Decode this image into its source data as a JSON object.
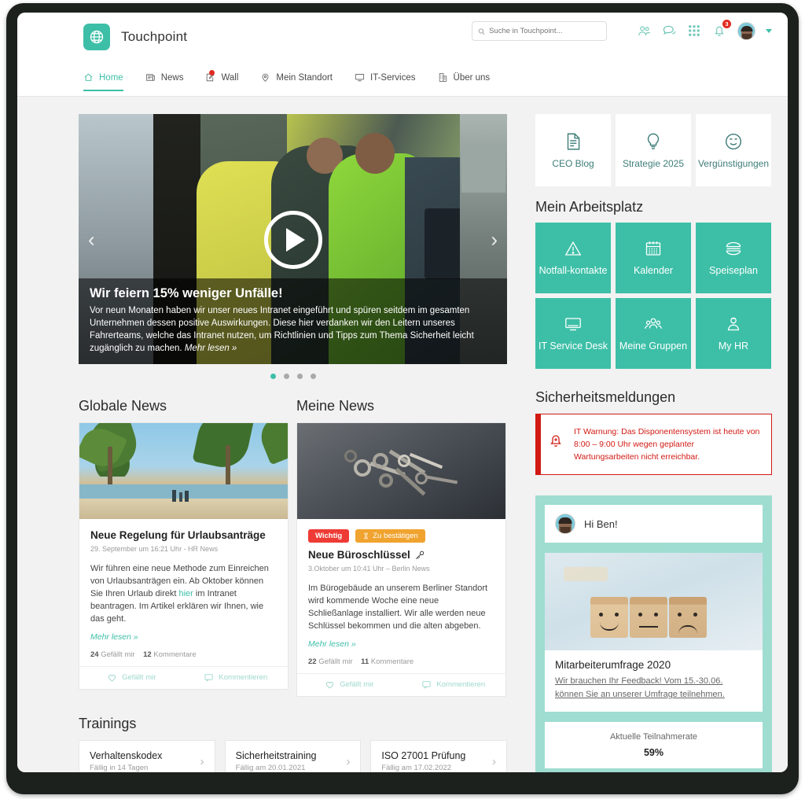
{
  "brand": {
    "name": "Touchpoint",
    "logo_icon": "globe-icon",
    "accent": "#3dbfa7"
  },
  "header": {
    "search": {
      "placeholder": "Suche in Touchpoint...",
      "value": "",
      "icon": "search-icon"
    },
    "icons": [
      {
        "name": "people-icon",
        "label": "Kontakte"
      },
      {
        "name": "chat-icon",
        "label": "Chat"
      },
      {
        "name": "apps-grid-icon",
        "label": "Apps"
      },
      {
        "name": "bell-icon",
        "label": "Benachrichtigungen",
        "badge": "3"
      }
    ],
    "avatar": {
      "name": "user-avatar",
      "caret": "chevron-down-icon"
    }
  },
  "nav": {
    "items": [
      {
        "label": "Home",
        "icon": "home-icon",
        "active": true,
        "dot": false
      },
      {
        "label": "News",
        "icon": "newspaper-icon",
        "active": false,
        "dot": false
      },
      {
        "label": "Wall",
        "icon": "pencil-note-icon",
        "active": false,
        "dot": true
      },
      {
        "label": "Mein Standort",
        "icon": "location-pin-icon",
        "active": false,
        "dot": false
      },
      {
        "label": "IT-Services",
        "icon": "monitor-icon",
        "active": false,
        "dot": false
      },
      {
        "label": "Über uns",
        "icon": "building-icon",
        "active": false,
        "dot": false
      }
    ]
  },
  "hero": {
    "title": "Wir feiern 15% weniger Unfälle!",
    "text": "Vor neun Monaten haben wir unser neues Intranet eingeführt und spüren seitdem im gesamten Unternehmen dessen positive Auswirkungen. Diese hier verdanken wir den Leitern unseres Fahrerteams, welche das Intranet nutzen, um Richtlinien und Tipps zum Thema Sicherheit leicht zugänglich zu machen.",
    "more": "Mehr lesen »",
    "play_icon": "play-icon",
    "prev_icon": "chevron-left-icon",
    "next_icon": "chevron-right-icon",
    "slides": 4,
    "active_slide": 1
  },
  "news": {
    "global": {
      "heading": "Globale News",
      "image": "beach-palm-trees-photo",
      "title": "Neue Regelung für Urlaubsanträge",
      "meta": "29. September um 16:21 Uhr  -  HR News",
      "text_before": "Wir führen eine neue Methode zum Einreichen von Urlaubsanträgen ein. Ab Oktober können Sie Ihren Urlaub direkt ",
      "link": "hier",
      "text_after": " im Intranet beantragen. Im Artikel erklären wir Ihnen, wie das geht.",
      "more": "Mehr lesen »",
      "likes_count": "24",
      "likes_label": "Gefällt mir",
      "comments_count": "12",
      "comments_label": "Kommentare",
      "action_like": "Gefällt mir",
      "action_comment": "Kommentieren"
    },
    "mine": {
      "heading": "Meine News",
      "image": "keys-on-dark-table-photo",
      "badges": [
        {
          "label": "Wichtig",
          "color": "#ee3b35"
        },
        {
          "label": "Zu bestätigen",
          "color": "#f0a32e",
          "icon": "hourglass-icon"
        }
      ],
      "title": "Neue Büroschlüssel",
      "title_icon": "key-icon",
      "meta": "3.Oktober um 10:41 Uhr – Berlin News",
      "text": "Im Bürogebäude an unserem Berliner Standort wird kommende Woche eine neue Schließanlage installiert. Wir alle werden neue Schlüssel bekommen und die alten abgeben.",
      "more": "Mehr lesen »",
      "likes_count": "22",
      "likes_label": "Gefällt mir",
      "comments_count": "11",
      "comments_label": "Kommentare",
      "action_like": "Gefällt mir",
      "action_comment": "Kommentieren"
    }
  },
  "trainings": {
    "heading": "Trainings",
    "items": [
      {
        "title": "Verhaltenskodex",
        "due": "Fällig in 14 Tagen",
        "chevron": "chevron-right-icon"
      },
      {
        "title": "Sicherheitstraining",
        "due": "Fällig am 20.01.2021",
        "chevron": "chevron-right-icon"
      },
      {
        "title": "ISO 27001 Prüfung",
        "due": "Fällig am 17.02.2022",
        "chevron": "chevron-right-icon"
      }
    ]
  },
  "quicklinks": [
    {
      "label": "CEO Blog",
      "icon": "document-lines-icon"
    },
    {
      "label": "Strategie 2025",
      "icon": "lightbulb-icon"
    },
    {
      "label": "Vergünstigungen",
      "icon": "smiley-icon"
    }
  ],
  "workplace": {
    "heading": "Mein Arbeitsplatz",
    "tiles": [
      {
        "label": "Notfall-kontakte",
        "icon": "warning-triangle-icon"
      },
      {
        "label": "Kalender",
        "icon": "calendar-icon"
      },
      {
        "label": "Speiseplan",
        "icon": "burger-icon"
      },
      {
        "label": "IT Service Desk",
        "icon": "monitor-icon"
      },
      {
        "label": "Meine Gruppen",
        "icon": "group-people-icon"
      },
      {
        "label": "My HR",
        "icon": "person-badge-icon"
      }
    ]
  },
  "security": {
    "heading": "Sicherheitsmeldungen",
    "alert": {
      "icon": "alert-bell-icon",
      "text": "IT Warnung: Das Disponentensystem ist heute von 8:00 – 9:00 Uhr wegen geplanter Wartungsarbeiten nicht erreichbar.",
      "color": "#d11a14"
    }
  },
  "survey": {
    "greeting": "Hi Ben!",
    "avatar": "user-avatar",
    "image": "wooden-blocks-faces-photo",
    "title": "Mitarbeiterumfrage 2020",
    "link_line1": "Wir brauchen Ihr Feedback! Vom 15.-30.06.",
    "link_line2": "können Sie an unserer Umfrage teilnehmen.",
    "rate_label": "Aktuelle Teilnahmerate",
    "rate_value": "59%"
  }
}
